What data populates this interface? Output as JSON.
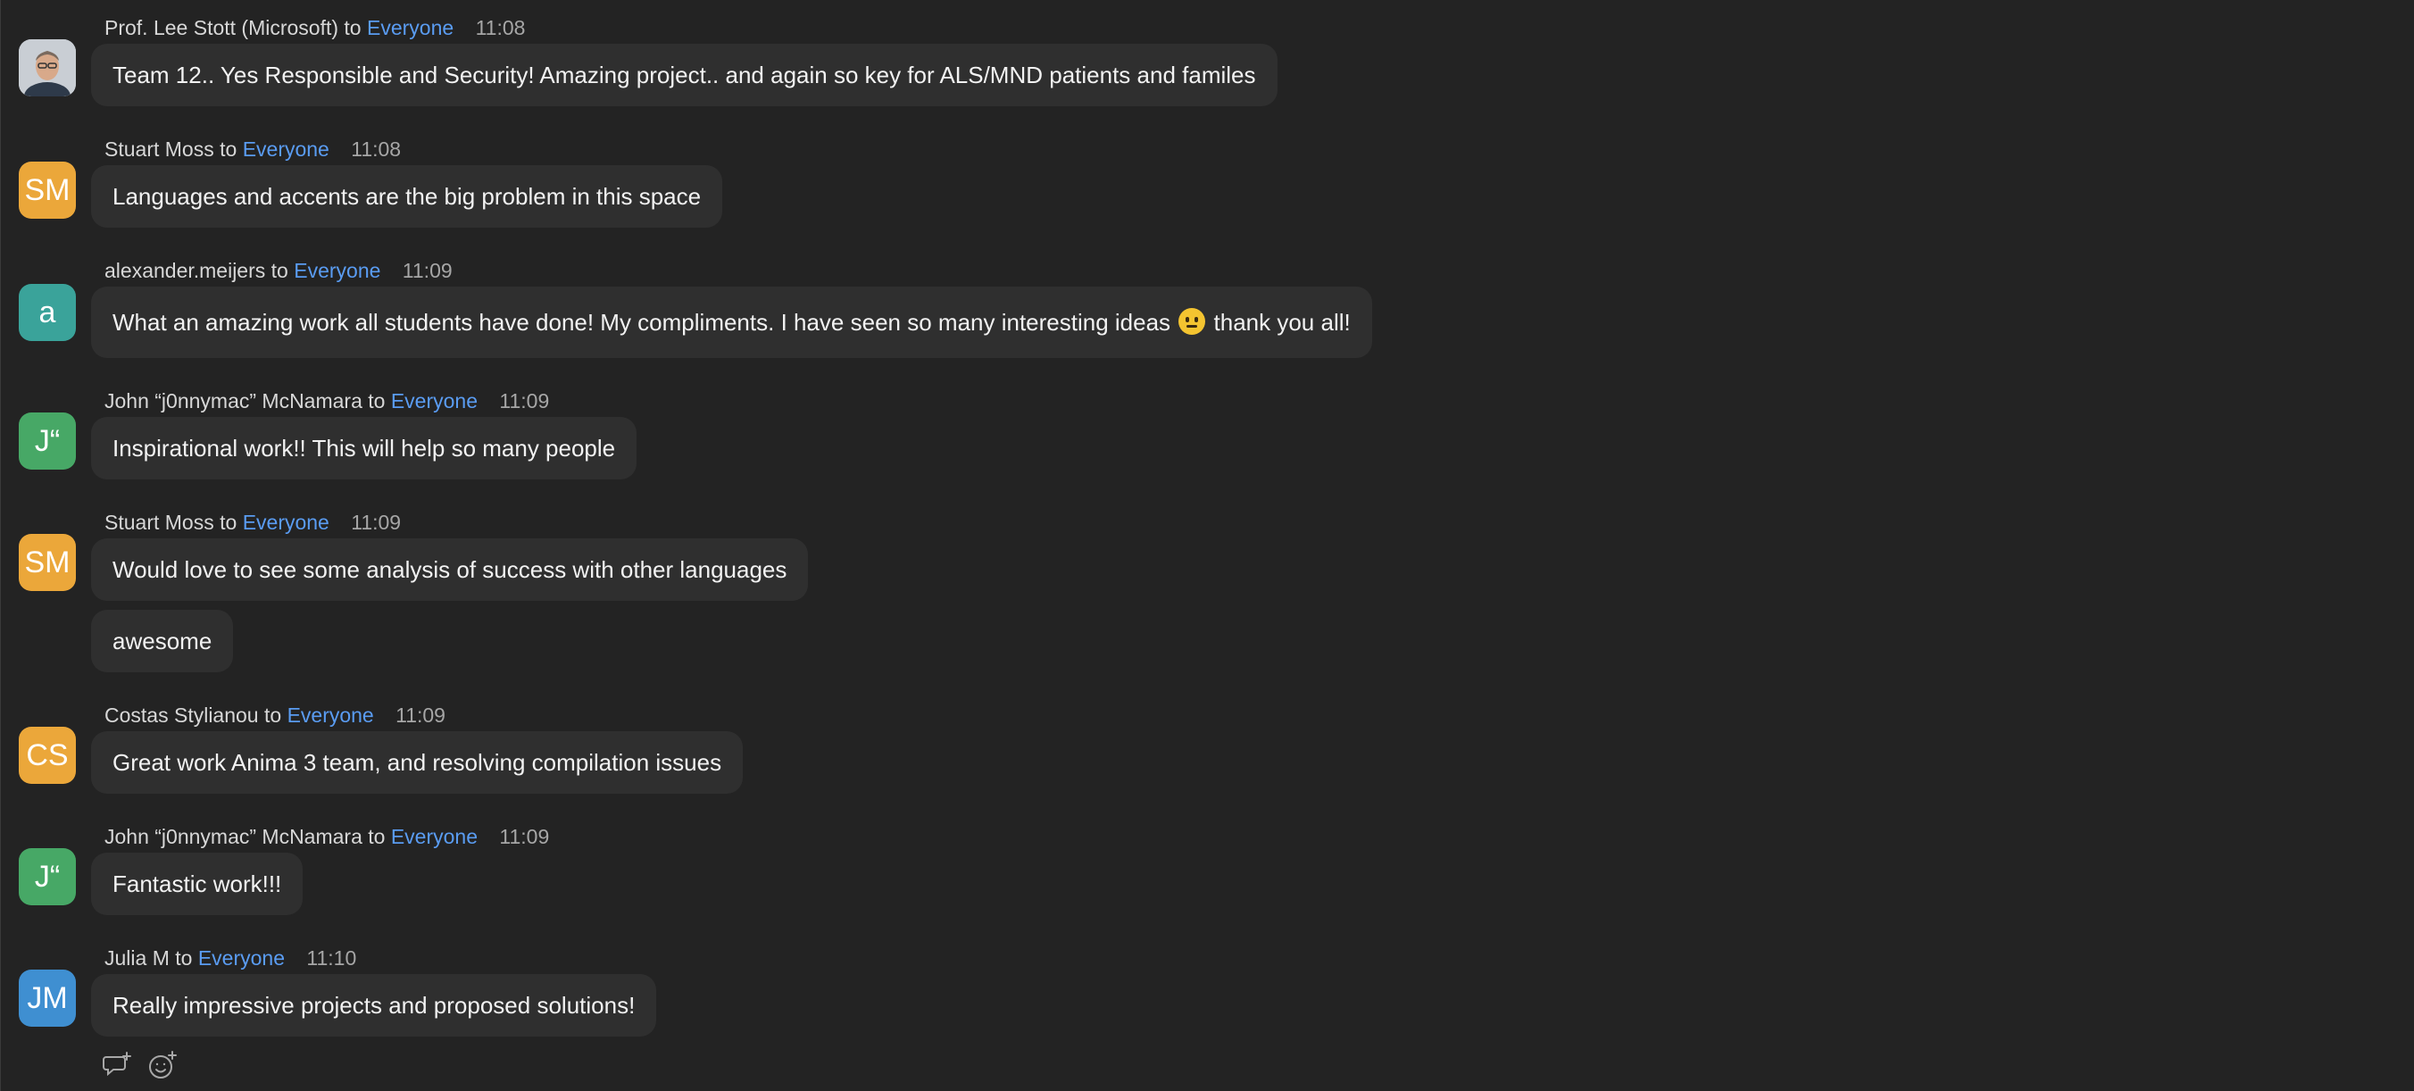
{
  "messages": [
    {
      "sender": "Prof. Lee Stott (Microsoft)",
      "to_word": "to",
      "recipient": "Everyone",
      "time": "11:08",
      "avatar_initials": "",
      "avatar_color": "#7b8390",
      "avatar_is_photo": true,
      "text": "Team 12.. Yes Responsible and Security! Amazing project.. and again so key for ALS/MND patients and familes"
    },
    {
      "sender": "Stuart Moss",
      "to_word": "to",
      "recipient": "Everyone",
      "time": "11:08",
      "avatar_initials": "SM",
      "avatar_color": "#eba73a",
      "text": "Languages and accents are the big problem in this space"
    },
    {
      "sender": "alexander.meijers",
      "to_word": "to",
      "recipient": "Everyone",
      "time": "11:09",
      "avatar_initials": "a",
      "avatar_color": "#3aa39a",
      "text_before_emoji": "What an amazing work all students have done! My compliments. I have seen so many interesting ideas",
      "emoji": "slightly-smiling-face",
      "text_after_emoji": "thank you all!"
    },
    {
      "sender": "John “j0nnymac” McNamara",
      "to_word": "to",
      "recipient": "Everyone",
      "time": "11:09",
      "avatar_initials": "J“",
      "avatar_color": "#47a866",
      "text": "Inspirational work!! This will help so many people"
    },
    {
      "sender": "Stuart Moss",
      "to_word": "to",
      "recipient": "Everyone",
      "time": "11:09",
      "avatar_initials": "SM",
      "avatar_color": "#eba73a",
      "text": "Would love to see some analysis of success with other languages",
      "followup_text": "awesome"
    },
    {
      "sender": "Costas Stylianou",
      "to_word": "to",
      "recipient": "Everyone",
      "time": "11:09",
      "avatar_initials": "CS",
      "avatar_color": "#eba73a",
      "text": "Great work Anima 3 team, and resolving compilation issues"
    },
    {
      "sender": "John “j0nnymac” McNamara",
      "to_word": "to",
      "recipient": "Everyone",
      "time": "11:09",
      "avatar_initials": "J“",
      "avatar_color": "#47a866",
      "text": "Fantastic work!!!"
    },
    {
      "sender": "Julia M",
      "to_word": "to",
      "recipient": "Everyone",
      "time": "11:10",
      "avatar_initials": "JM",
      "avatar_color": "#3f8fd1",
      "text": "Really impressive projects and proposed solutions!"
    }
  ],
  "actions": {
    "reply_icon": "reply-thread-icon",
    "react_icon": "add-reaction-icon"
  }
}
